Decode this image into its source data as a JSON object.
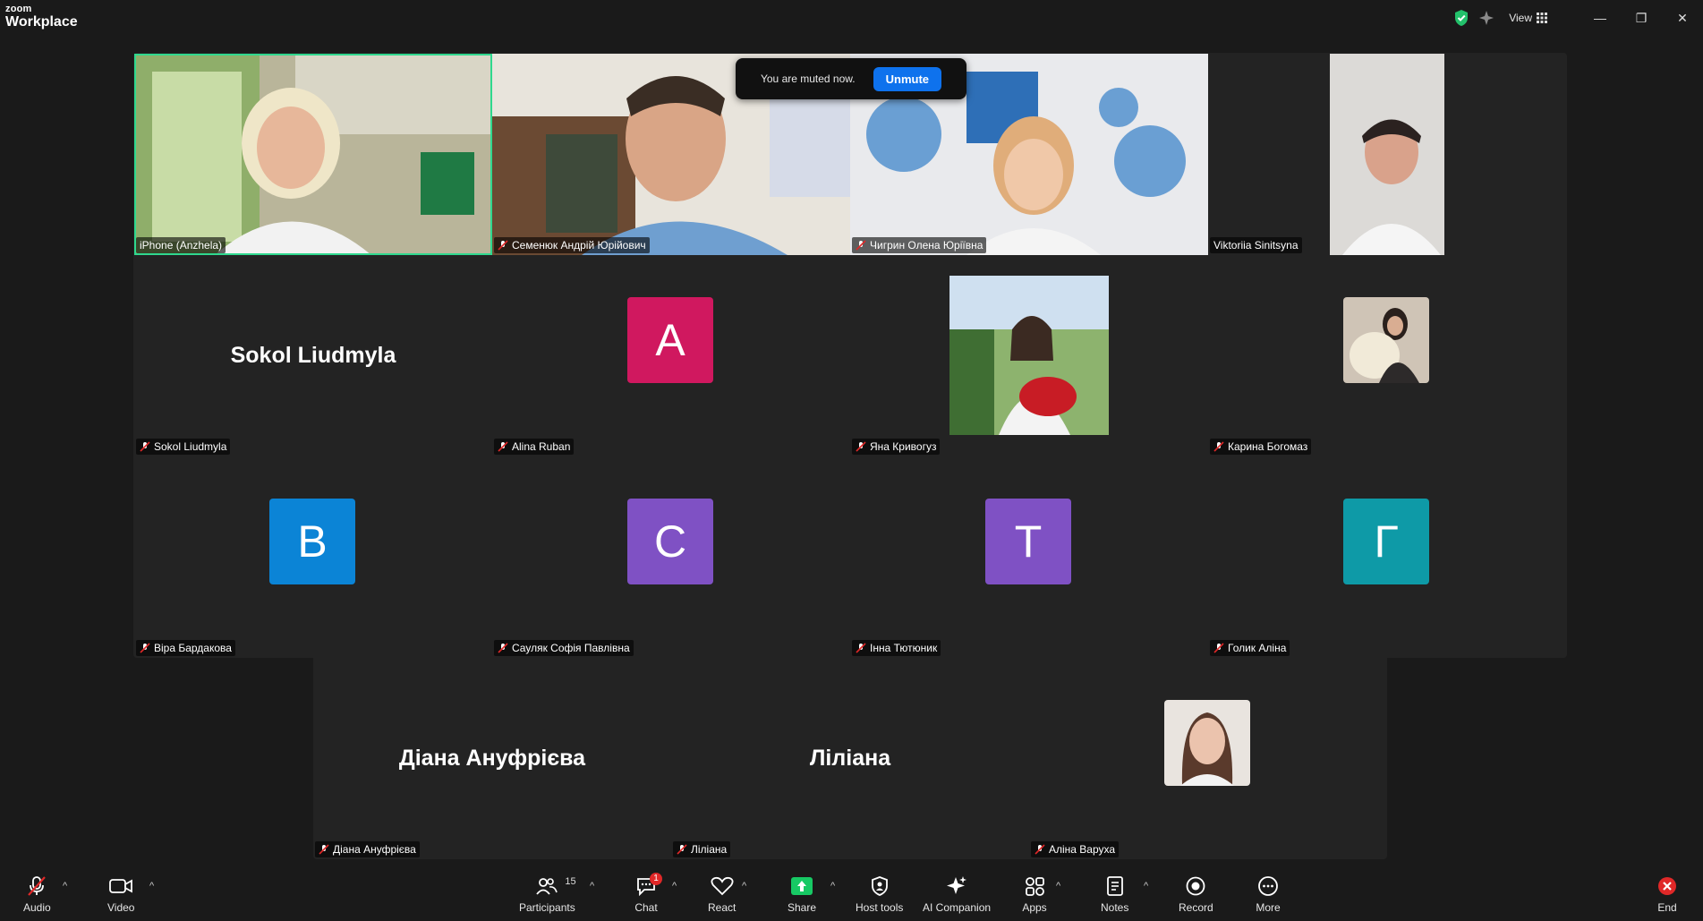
{
  "app": {
    "brand_small": "zoom",
    "brand_big": "Workplace",
    "view_label": "View"
  },
  "window_buttons": [
    "—",
    "❐",
    "✕"
  ],
  "toast": {
    "message": "You are muted now.",
    "unmute_label": "Unmute"
  },
  "participants": [
    {
      "name": "iPhone (Anzhela)",
      "muted": false,
      "active": true
    },
    {
      "name": "Семенюк Андрій Юрійович",
      "muted": true
    },
    {
      "name": "Чигрин Олена Юріївна",
      "muted": true
    },
    {
      "name": "Viktoriia Sinitsyna",
      "muted": false
    },
    {
      "name": "Sokol Liudmyla",
      "muted": true,
      "display_text": "Sokol Liudmyla"
    },
    {
      "name": "Alina Ruban",
      "muted": true,
      "initial": "A",
      "color": "#d0185f"
    },
    {
      "name": "Яна Кривогуз",
      "muted": true
    },
    {
      "name": "Карина Богомаз",
      "muted": true
    },
    {
      "name": "Віра Бардакова",
      "muted": true,
      "initial": "B",
      "color": "#0b84d6"
    },
    {
      "name": "Сауляк Софія Павлівна",
      "muted": true,
      "initial": "C",
      "color": "#7f51c4"
    },
    {
      "name": "Інна Тютюник",
      "muted": true,
      "initial": "T",
      "color": "#7f51c4"
    },
    {
      "name": "Голик Аліна",
      "muted": true,
      "initial": "Г",
      "color": "#0e9aa7"
    },
    {
      "name": "Діана Ануфрієва",
      "muted": true,
      "display_text": "Діана Ануфрієва"
    },
    {
      "name": "Ліліана",
      "muted": true,
      "display_text": "Ліліана"
    },
    {
      "name": "Аліна Варуха",
      "muted": true
    }
  ],
  "toolbar": {
    "audio": "Audio",
    "video": "Video",
    "participants": "Participants",
    "participants_count": "15",
    "chat": "Chat",
    "chat_badge": "1",
    "react": "React",
    "share": "Share",
    "host_tools": "Host tools",
    "ai_companion": "AI Companion",
    "apps": "Apps",
    "notes": "Notes",
    "record": "Record",
    "more": "More",
    "end": "End"
  },
  "colors": {
    "accent_blue": "#0e72ed",
    "active_speaker": "#2fd88e",
    "share_green": "#17c964",
    "end_red": "#e02828"
  }
}
